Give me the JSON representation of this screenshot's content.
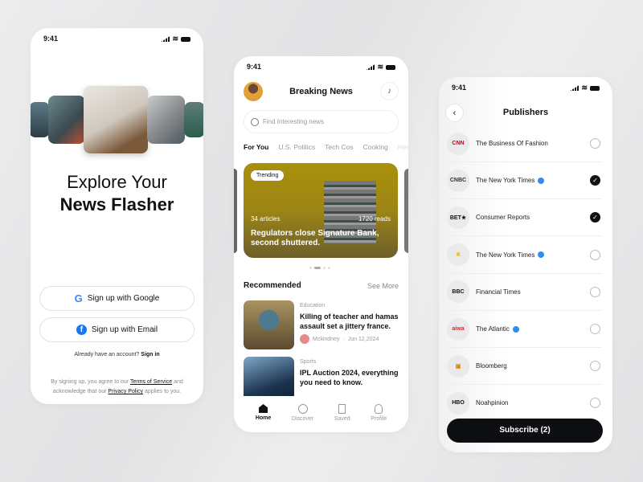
{
  "status_time": "9:41",
  "onboarding": {
    "title_line1": "Explore Your",
    "title_line2": "News Flasher",
    "google_btn": "Sign up with Google",
    "email_btn": "Sign up with Email",
    "have_account": "Already have an account?",
    "sign_in": "Sign in",
    "legal_1": "By signing up, you agree to our",
    "terms": "Terms of Service",
    "legal_2": "and",
    "legal_3": "acknowledge that our",
    "privacy": "Privacy Policy",
    "legal_4": "applies to you."
  },
  "home": {
    "title": "Breaking News",
    "search_placeholder": "Find Interesting news",
    "tabs": [
      "For You",
      "U.S. Politics",
      "Tech Cos",
      "Cooking",
      "Health"
    ],
    "featured": {
      "badge": "Trending",
      "articles": "34 articles",
      "reads": "1720 reads",
      "headline": "Regulators close Signature Bank, second shuttered."
    },
    "recommended_title": "Recommended",
    "see_more": "See More",
    "items": [
      {
        "category": "Education",
        "title": "Killing of teacher and hamas assault set a jittery france.",
        "author": "Mckindney",
        "date": "Jun 12,2024"
      },
      {
        "category": "Sports",
        "title": "IPL Auction 2024, everything you need to know."
      }
    ],
    "nav": [
      "Home",
      "Discover",
      "Saved",
      "Profile"
    ]
  },
  "publishers": {
    "title": "Publishers",
    "items": [
      {
        "logo": "CNN",
        "name": "The Business Of Fashion",
        "verified": false,
        "checked": false,
        "color": "#d0021b"
      },
      {
        "logo": "CNBC",
        "name": "The New York Times",
        "verified": true,
        "checked": true,
        "color": "#333"
      },
      {
        "logo": "BET★",
        "name": "Consumer Reports",
        "verified": false,
        "checked": true,
        "color": "#111"
      },
      {
        "logo": "✖",
        "name": "The New York Times",
        "verified": true,
        "checked": false,
        "color": "#f5c400"
      },
      {
        "logo": "BBC",
        "name": "Financial Times",
        "verified": false,
        "checked": false,
        "color": "#111"
      },
      {
        "logo": "aiwa",
        "name": "The Atlantic",
        "verified": true,
        "checked": false,
        "color": "#e0262f"
      },
      {
        "logo": "▣",
        "name": "Bloomberg",
        "verified": false,
        "checked": false,
        "color": "#d98a00"
      },
      {
        "logo": "HBO",
        "name": "Noahpinion",
        "verified": false,
        "checked": false,
        "color": "#111"
      }
    ],
    "subscribe": "Subscribe (2)"
  }
}
